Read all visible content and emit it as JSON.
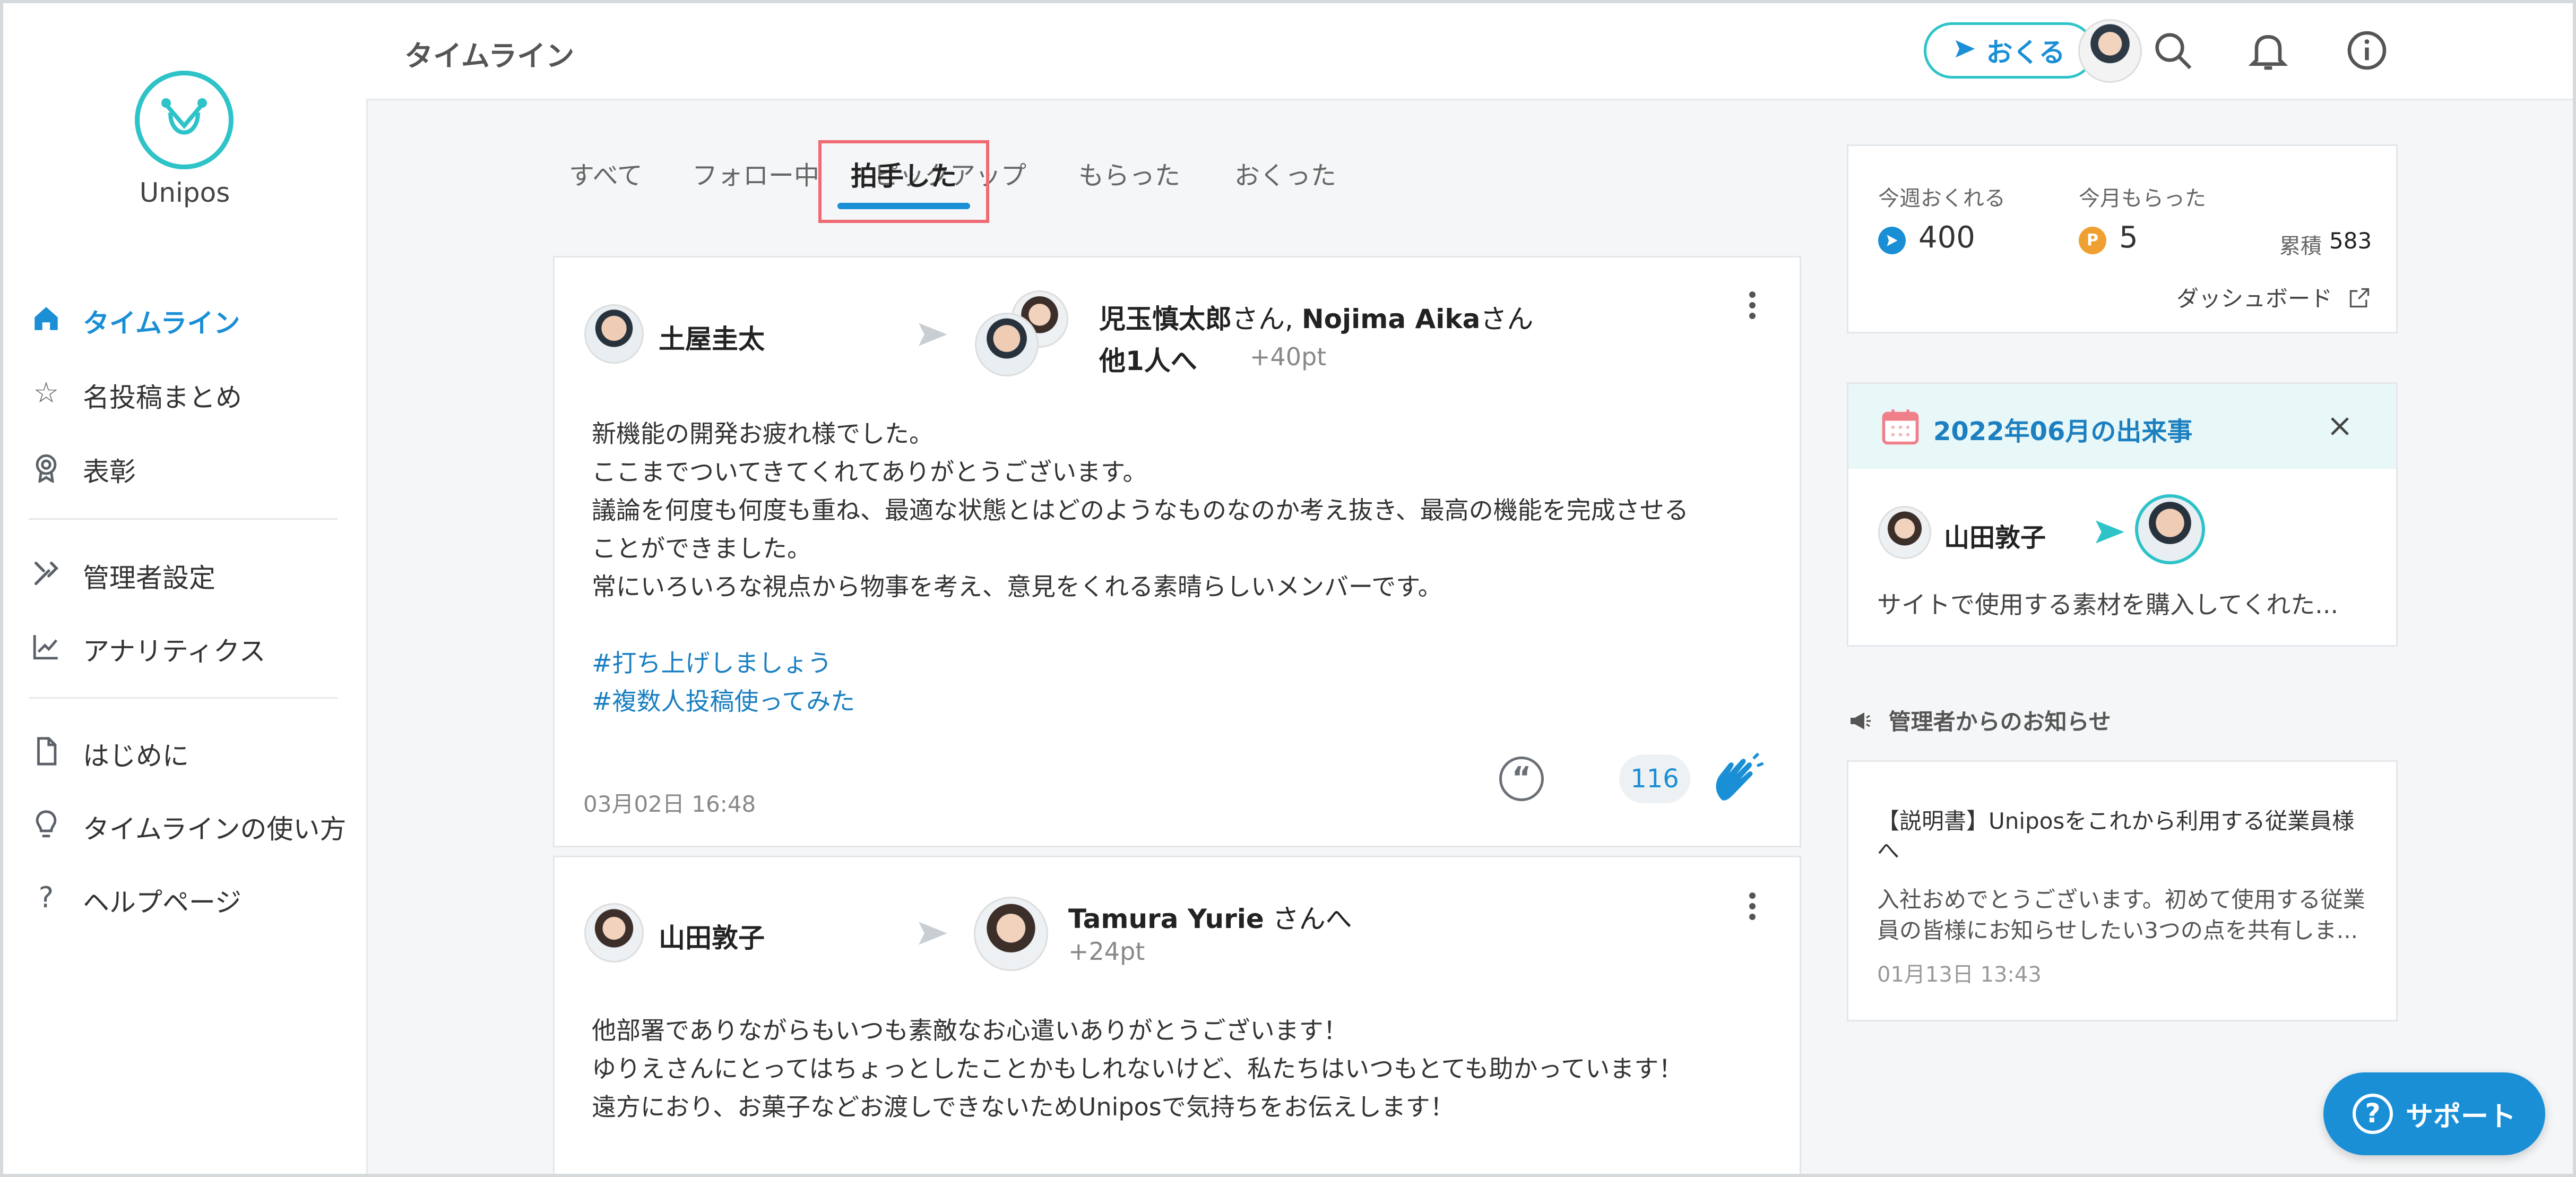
{
  "app": {
    "name": "Unipos"
  },
  "sidebar": {
    "items": [
      {
        "label": "タイムライン",
        "icon": "home-icon",
        "active": true
      },
      {
        "label": "名投稿まとめ",
        "icon": "star-icon"
      },
      {
        "label": "表彰",
        "icon": "award-icon"
      },
      {
        "label": "管理者設定",
        "icon": "tools-icon"
      },
      {
        "label": "アナリティクス",
        "icon": "chart-icon"
      },
      {
        "label": "はじめに",
        "icon": "document-icon"
      },
      {
        "label": "タイムラインの使い方",
        "icon": "lightbulb-icon"
      },
      {
        "label": "ヘルプページ",
        "icon": "question-icon"
      }
    ]
  },
  "header": {
    "title": "タイムライン",
    "send_label": "おくる"
  },
  "tabs": [
    {
      "label": "すべて"
    },
    {
      "label": "フォロー中"
    },
    {
      "label": "ピックアップ"
    },
    {
      "label": "もらった"
    },
    {
      "label": "おくった"
    },
    {
      "label": "拍手した",
      "active": true
    }
  ],
  "posts": [
    {
      "sender": "土屋圭太",
      "recipient_names": "児玉慎太郎",
      "recipient_san1": "さん,",
      "recipient_names2": "Nojima Aika",
      "recipient_san2": "さん",
      "recipient_more": "他1人へ",
      "points": "+40pt",
      "body": [
        "新機能の開発お疲れ様でした。",
        "ここまでついてきてくれてありがとうございます。",
        "議論を何度も何度も重ね、最適な状態とはどのようなものなのか考え抜き、最高の機能を完成させる",
        "ことができました。",
        "常にいろいろな視点から物事を考え、意見をくれる素晴らしいメンバーです。"
      ],
      "tags": [
        "#打ち上げしましょう",
        "#複数人投稿使ってみた"
      ],
      "date": "03月02日 16:48",
      "claps": "116"
    },
    {
      "sender": "山田敦子",
      "recipient_names": "Tamura Yurie",
      "recipient_suffix": " さんへ",
      "points": "+24pt",
      "body": [
        "他部署でありながらもいつも素敵なお心遣いありがとうございます！",
        "ゆりえさんにとってはちょっとしたことかもしれないけど、私たちはいつもとても助かっています！",
        "遠方におり、お菓子などお渡しできないためUniposで気持ちをお伝えします！"
      ]
    }
  ],
  "stats": {
    "weekly_label": "今週おくれる",
    "weekly_value": "400",
    "monthly_label": "今月もらった",
    "monthly_value": "5",
    "total_label": "累積",
    "total_value": "583",
    "dashboard_label": "ダッシュボード"
  },
  "event": {
    "title": "2022年06月の出来事",
    "sender": "山田敦子",
    "message": "サイトで使用する素材を購入してくれた..."
  },
  "notices": {
    "heading": "管理者からのお知らせ",
    "title_line1": "【説明書】Uniposをこれから利用する従業員様",
    "title_line2": "へ",
    "body_line1": "入社おめでとうございます。初めて使用する従業",
    "body_line2": "員の皆様にお知らせしたい3つの点を共有しま...",
    "date": "01月13日 13:43"
  },
  "support": {
    "label": "サポート"
  },
  "colors": {
    "accent": "#1a8fd6",
    "brand": "#2ec3c8",
    "tab_highlight": "#ef6a72",
    "point_orange": "#f0a030"
  }
}
